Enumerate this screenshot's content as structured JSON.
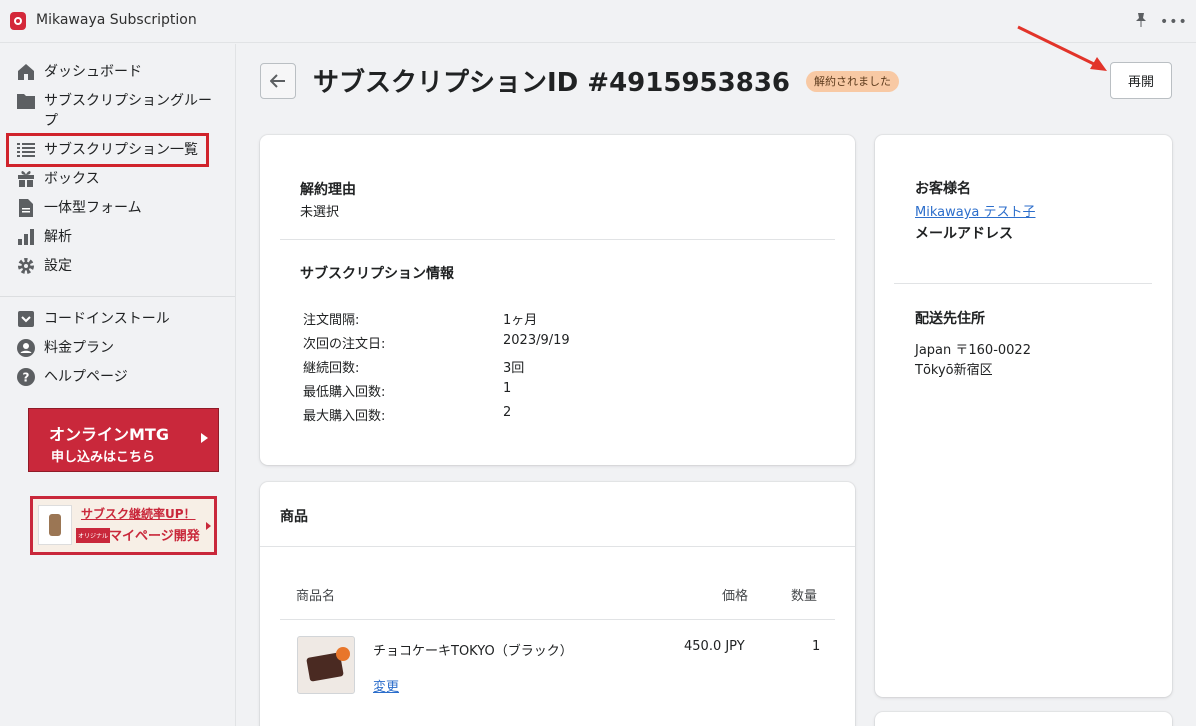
{
  "app": {
    "title": "Mikawaya Subscription"
  },
  "sidebar": {
    "items": [
      {
        "label": "ダッシュボード",
        "icon": "home-icon"
      },
      {
        "label": "サブスクリプショングループ",
        "icon": "folder-icon"
      },
      {
        "label": "サブスクリプション一覧",
        "icon": "list-icon"
      },
      {
        "label": "ボックス",
        "icon": "gift-icon"
      },
      {
        "label": "一体型フォーム",
        "icon": "document-icon"
      },
      {
        "label": "解析",
        "icon": "bar-chart-icon"
      },
      {
        "label": "設定",
        "icon": "gear-icon"
      }
    ],
    "secondary": [
      {
        "label": "コードインストール",
        "icon": "download-icon"
      },
      {
        "label": "料金プラン",
        "icon": "user-icon"
      },
      {
        "label": "ヘルプページ",
        "icon": "help-icon"
      }
    ],
    "banner_mtg": {
      "line1": "オンラインMTG",
      "line2": "申し込みはこちら"
    },
    "banner_sub": {
      "line1": "サブスク継続率UP！",
      "tag": "オリジナル",
      "line2": "マイページ開発"
    }
  },
  "header": {
    "title": "サブスクリプションID #4915953836",
    "badge": "解約されました",
    "resume_label": "再開"
  },
  "cancellation": {
    "heading": "解約理由",
    "value": "未選択"
  },
  "subscription_info": {
    "heading": "サブスクリプション情報",
    "rows": [
      {
        "label": "注文間隔:",
        "value": "1ヶ月"
      },
      {
        "label": "次回の注文日:",
        "value": "2023/9/19"
      },
      {
        "label": "継続回数:",
        "value": "3回"
      },
      {
        "label": "最低購入回数:",
        "value": "1"
      },
      {
        "label": "最大購入回数:",
        "value": "2"
      }
    ]
  },
  "products": {
    "heading": "商品",
    "columns": {
      "name": "商品名",
      "price": "価格",
      "qty": "数量"
    },
    "items": [
      {
        "name": "チョコケーキTOKYO（ブラック）",
        "price": "450.0 JPY",
        "qty": "1",
        "change_label": "変更"
      }
    ]
  },
  "customer": {
    "name_heading": "お客様名",
    "name": "Mikawaya テスト子",
    "email_heading": "メールアドレス",
    "address_heading": "配送先住所",
    "address_line1": "Japan 〒160-0022",
    "address_line2": "Tōkyō新宿区"
  },
  "colors": {
    "accent_red": "#d0232b",
    "link": "#2c6ecb",
    "badge_bg": "#f8c9a4"
  }
}
